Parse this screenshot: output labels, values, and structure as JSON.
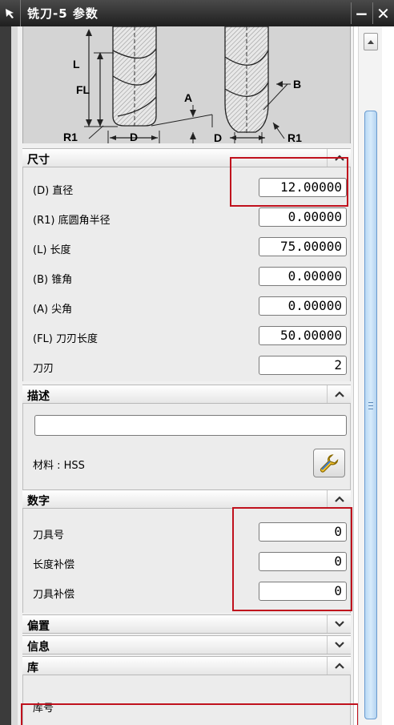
{
  "window": {
    "title": "铣刀-5 参数",
    "minimize_label": "−",
    "close_label": "✕"
  },
  "diagram": {
    "labels": {
      "l": "L",
      "fl": "FL",
      "r1_left": "R1",
      "d_left": "D",
      "a": "A",
      "b": "B",
      "d_right": "D",
      "r1_right": "R1"
    }
  },
  "sections": {
    "dimensions": {
      "title": "尺寸",
      "expanded": true,
      "rows": [
        {
          "label": "(D) 直径",
          "value": "12.00000"
        },
        {
          "label": "(R1) 底圆角半径",
          "value": "0.00000"
        },
        {
          "label": "(L) 长度",
          "value": "75.00000"
        },
        {
          "label": "(B) 锥角",
          "value": "0.00000"
        },
        {
          "label": "(A) 尖角",
          "value": "0.00000"
        },
        {
          "label": "(FL) 刀刃长度",
          "value": "50.00000"
        },
        {
          "label": "刀刃",
          "value": "2"
        }
      ]
    },
    "description": {
      "title": "描述",
      "expanded": true,
      "text_value": "",
      "material_label": "材料 : HSS"
    },
    "numbers": {
      "title": "数字",
      "expanded": true,
      "rows": [
        {
          "label": "刀具号",
          "value": "0"
        },
        {
          "label": "长度补偿",
          "value": "0"
        },
        {
          "label": "刀具补偿",
          "value": "0"
        }
      ]
    },
    "offset": {
      "title": "偏置",
      "expanded": false
    },
    "info": {
      "title": "信息",
      "expanded": false
    },
    "library": {
      "title": "库",
      "expanded": true,
      "library_number_label": "库号"
    }
  },
  "colors": {
    "highlight": "#c0111d",
    "titlebar": "#2b2b2b",
    "scroll_thumb": "#c6e0f7"
  }
}
